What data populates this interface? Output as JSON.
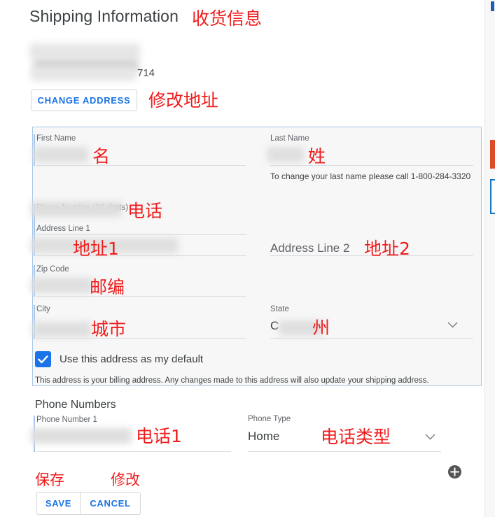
{
  "page": {
    "title": "Shipping Information",
    "title_annotation": "收货信息"
  },
  "address_summary": {
    "visible_tail": "714",
    "change_address_button": "CHANGE ADDRESS",
    "change_address_annotation": "修改地址",
    "redacted": true
  },
  "address_form": {
    "fields": {
      "first_name": {
        "label": "First Name",
        "value": "",
        "annotation": "名",
        "redacted": true
      },
      "last_name": {
        "label": "Last Name",
        "value": "",
        "annotation": "姓",
        "redacted": true,
        "helper": "To change your last name please call 1-800-284-3320"
      },
      "phone_number": {
        "label": "Phone Number (10 digits)",
        "value": "",
        "annotation": "电话",
        "redacted": true
      },
      "address_line_1": {
        "label": "Address Line 1",
        "value": "",
        "annotation": "地址1",
        "redacted": true
      },
      "address_line_2": {
        "label": "",
        "placeholder": "Address Line 2",
        "value": "",
        "annotation": "地址2",
        "redacted": false
      },
      "zip_code": {
        "label": "Zip Code",
        "value": "",
        "annotation": "邮编",
        "redacted": true
      },
      "city": {
        "label": "City",
        "value": "",
        "annotation": "城市",
        "redacted": true
      },
      "state": {
        "label": "State",
        "value": "C",
        "annotation": "州",
        "redacted": true,
        "chevron": "chevron-down-icon"
      }
    },
    "default_checkbox": {
      "checked": true,
      "label": "Use this address as my default"
    },
    "disclaimer": "This address is your billing address. Any changes made to this address will also update your shipping address."
  },
  "phone_section": {
    "title": "Phone Numbers",
    "phone_number_1": {
      "label": "Phone Number 1",
      "value": "",
      "annotation": "电话1",
      "redacted": true
    },
    "phone_type": {
      "label": "Phone Type",
      "value": "Home",
      "annotation": "电话类型",
      "chevron": "chevron-down-icon"
    },
    "add_button": "add-phone-icon"
  },
  "actions": {
    "save_label": "SAVE",
    "save_annotation": "保存",
    "cancel_label": "CANCEL",
    "cancel_annotation": "修改"
  },
  "colors": {
    "link_blue": "#1a73e8",
    "annotation_red": "#f01c1c",
    "panel_border": "#a7c6ea",
    "panel_bg": "#f7f7f7",
    "edge_red": "#dd4b29",
    "edge_blue": "#1778c3"
  }
}
